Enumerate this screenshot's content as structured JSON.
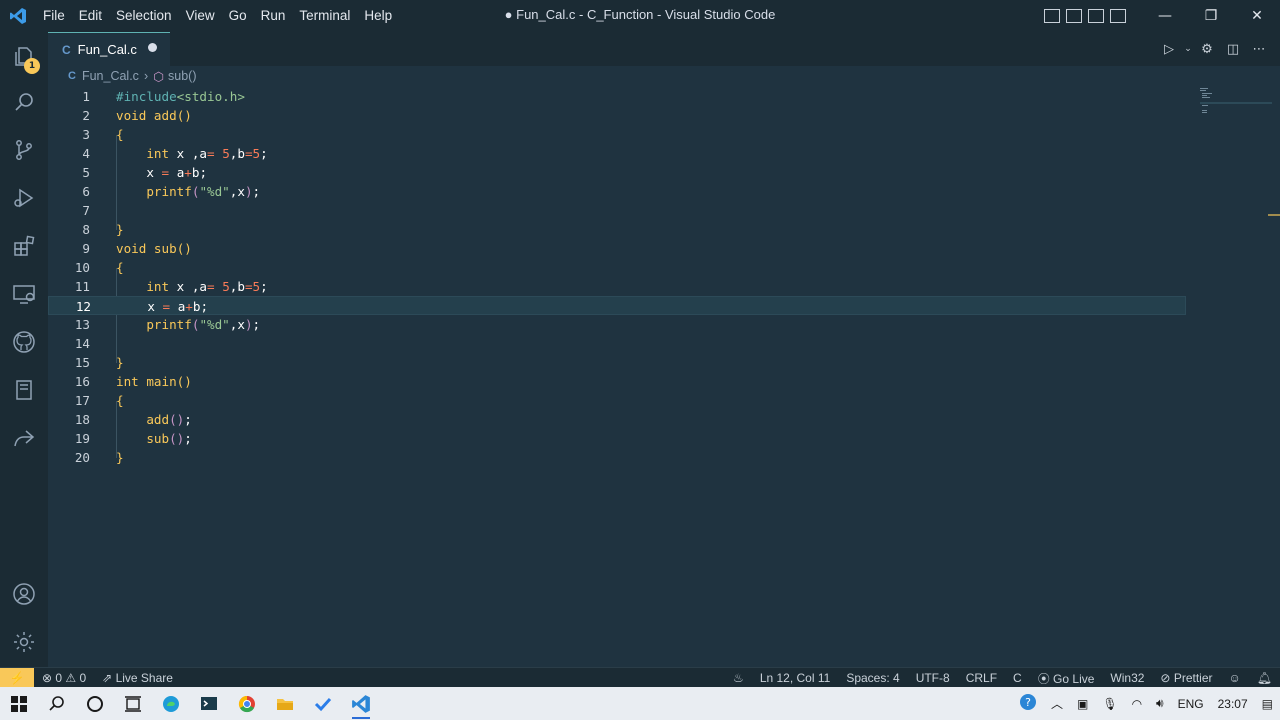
{
  "window": {
    "title": "● Fun_Cal.c - C_Function - Visual Studio Code",
    "menu": [
      "File",
      "Edit",
      "Selection",
      "View",
      "Go",
      "Run",
      "Terminal",
      "Help"
    ],
    "controls": {
      "minimize": "—",
      "restore": "❐",
      "close": "✕"
    }
  },
  "activity_bar": {
    "explorer_badge": "1",
    "icons": [
      "explorer-icon",
      "search-icon",
      "source-control-icon",
      "run-debug-icon",
      "extensions-icon",
      "remote-explorer-icon",
      "github-icon",
      "notebook-icon",
      "live-share-icon",
      "account-icon",
      "settings-gear-icon"
    ]
  },
  "tab": {
    "icon_letter": "C",
    "label": "Fun_Cal.c",
    "modified": true
  },
  "breadcrumb": {
    "file": "Fun_Cal.c",
    "symbol": "sub()"
  },
  "editor": {
    "cursor_line": 12,
    "lines": [
      {
        "n": "1"
      },
      {
        "n": "2"
      },
      {
        "n": "3"
      },
      {
        "n": "4"
      },
      {
        "n": "5"
      },
      {
        "n": "6"
      },
      {
        "n": "7"
      },
      {
        "n": "8"
      },
      {
        "n": "9"
      },
      {
        "n": "10"
      },
      {
        "n": "11"
      },
      {
        "n": "12"
      },
      {
        "n": "13"
      },
      {
        "n": "14"
      },
      {
        "n": "15"
      },
      {
        "n": "16"
      },
      {
        "n": "17"
      },
      {
        "n": "18"
      },
      {
        "n": "19"
      },
      {
        "n": "20"
      }
    ],
    "code": {
      "l1a": "#include",
      "l1b": "<stdio.h>",
      "l2a": "void",
      "l2b": " add",
      "l2c": "()",
      "l3": "{",
      "l4a": "int",
      "l4b": " x ,a",
      "l4c": "= ",
      "l4d": "5",
      "l4e": ",b",
      "l4f": "=",
      "l4g": "5",
      "l4h": ";",
      "l5a": "x ",
      "l5b": "=",
      "l5c": " a",
      "l5d": "+",
      "l5e": "b;",
      "l6a": "printf",
      "l6b": "(",
      "l6c": "\"%d\"",
      "l6d": ",x",
      "l6e": ")",
      "l6f": ";",
      "l8": "}",
      "l9a": "void",
      "l9b": " sub",
      "l9c": "()",
      "l10": "{",
      "l11a": "int",
      "l11b": " x ,a",
      "l11c": "= ",
      "l11d": "5",
      "l11e": ",b",
      "l11f": "=",
      "l11g": "5",
      "l11h": ";",
      "l12a": "x ",
      "l12b": "=",
      "l12c": " a",
      "l12d": "+",
      "l12e": "b;",
      "l13a": "printf",
      "l13b": "(",
      "l13c": "\"%d\"",
      "l13d": ",x",
      "l13e": ")",
      "l13f": ";",
      "l15": "}",
      "l16a": "int",
      "l16b": " main",
      "l16c": "()",
      "l17": "{",
      "l18a": "add",
      "l18b": "()",
      "l18c": ";",
      "l19a": "sub",
      "l19b": "()",
      "l19c": ";",
      "l20": "}"
    }
  },
  "statusbar": {
    "remote_icon": "remote-icon",
    "problems": "⊗ 0 ⚠ 0",
    "live_share": "Live Share",
    "position": "Ln 12, Col 11",
    "spaces": "Spaces: 4",
    "encoding": "UTF-8",
    "eol": "CRLF",
    "language": "C",
    "go_live": "Go Live",
    "platform": "Win32",
    "prettier": "Prettier"
  },
  "taskbar": {
    "language": "ENG",
    "time": "23:07"
  },
  "colors": {
    "accent": "#f9c859",
    "background": "#1f3340",
    "sidebar": "#1b2b34"
  }
}
